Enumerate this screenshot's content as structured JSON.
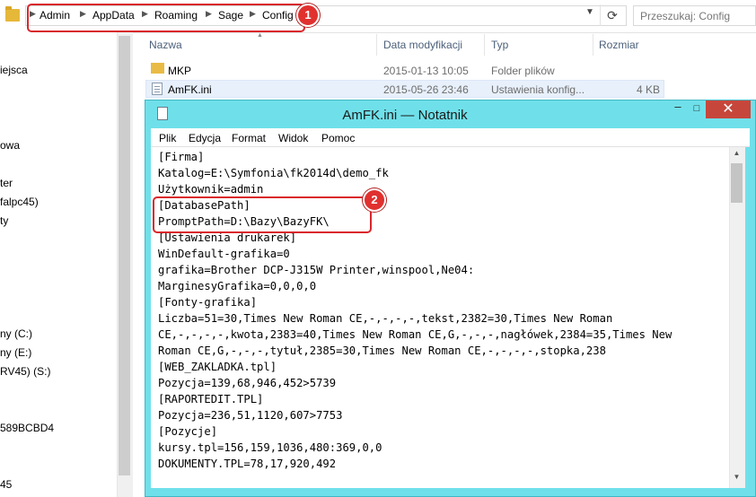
{
  "explorer": {
    "breadcrumb": [
      "Admin",
      "AppData",
      "Roaming",
      "Sage",
      "Config"
    ],
    "search_placeholder": "Przeszukaj: Config",
    "nav_items": [
      "iejsca",
      "owa",
      "ter",
      "falpc45)",
      "ty",
      "ny (C:)",
      "ny (E:)",
      "RV45) (S:)",
      "589BCBD4",
      "45"
    ],
    "columns": {
      "name": "Nazwa",
      "date": "Data modyfikacji",
      "type": "Typ",
      "size": "Rozmiar"
    },
    "files": [
      {
        "name": "MKP",
        "date": "2015-01-13 10:05",
        "type": "Folder plików",
        "size": ""
      },
      {
        "name": "AmFK.ini",
        "date": "2015-05-26 23:46",
        "type": "Ustawienia konfig...",
        "size": "4 KB"
      }
    ]
  },
  "callouts": [
    "1",
    "2"
  ],
  "notepad": {
    "title": "AmFK.ini — Notatnik",
    "controls": {
      "minimize": "–",
      "maximize": "□",
      "close": "✕"
    },
    "menu": [
      "Plik",
      "Edycja",
      "Format",
      "Widok",
      "Pomoc"
    ],
    "lines": [
      "[Firma]",
      "Katalog=E:\\Symfonia\\fk2014d\\demo_fk",
      "Użytkownik=admin",
      "[DatabasePath]",
      "PromptPath=D:\\Bazy\\BazyFK\\",
      "[Ustawienia drukarek]",
      "WinDefault-grafika=0",
      "grafika=Brother DCP-J315W Printer,winspool,Ne04:",
      "MarginesyGrafika=0,0,0,0",
      "[Fonty-grafika]",
      "Liczba=51=30,Times New Roman CE,-,-,-,-,tekst,2382=30,Times New Roman",
      "CE,-,-,-,-,kwota,2383=40,Times New Roman CE,G,-,-,-,nagłówek,2384=35,Times New",
      "Roman CE,G,-,-,-,tytuł,2385=30,Times New Roman CE,-,-,-,-,stopka,238",
      "[WEB_ZAKLADKA.tpl]",
      "Pozycja=139,68,946,452>5739",
      "[RAPORTEDIT.TPL]",
      "Pozycja=236,51,1120,607>7753",
      "[Pozycje]",
      "kursy.tpl=156,159,1036,480:369,0,0",
      "DOKUMENTY.TPL=78,17,920,492"
    ]
  }
}
